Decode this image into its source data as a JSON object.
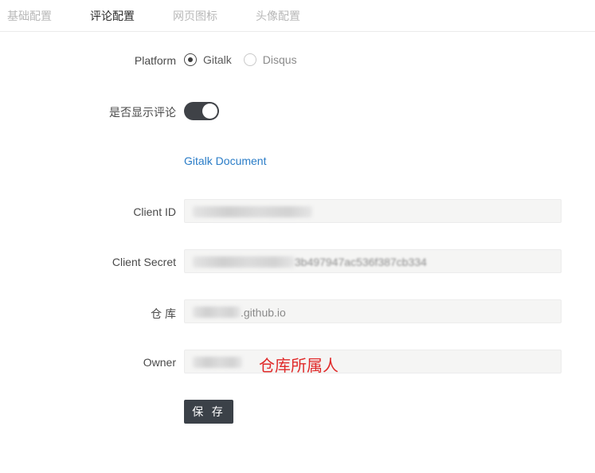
{
  "tabs": [
    {
      "label": "基础配置",
      "active": false
    },
    {
      "label": "评论配置",
      "active": true
    },
    {
      "label": "网页图标",
      "active": false
    },
    {
      "label": "头像配置",
      "active": false
    }
  ],
  "form": {
    "platform": {
      "label": "Platform",
      "options": [
        {
          "label": "Gitalk",
          "selected": true
        },
        {
          "label": "Disqus",
          "selected": false
        }
      ]
    },
    "show_comments": {
      "label": "是否显示评论",
      "enabled": true
    },
    "doc_link": "Gitalk Document",
    "client_id": {
      "label": "Client ID",
      "value": ""
    },
    "client_secret": {
      "label": "Client Secret",
      "value_visible_tail": "3b497947ac536f387cb334"
    },
    "repo": {
      "label": "仓 库",
      "value_visible_tail": ".github.io"
    },
    "owner": {
      "label": "Owner",
      "value": ""
    },
    "save_label": "保 存"
  },
  "annotation": {
    "text": "仓库所属人",
    "color": "#e02a2a"
  },
  "colors": {
    "accent": "#3b4148",
    "link": "#2a7cc7",
    "annotation": "#e02a2a"
  }
}
